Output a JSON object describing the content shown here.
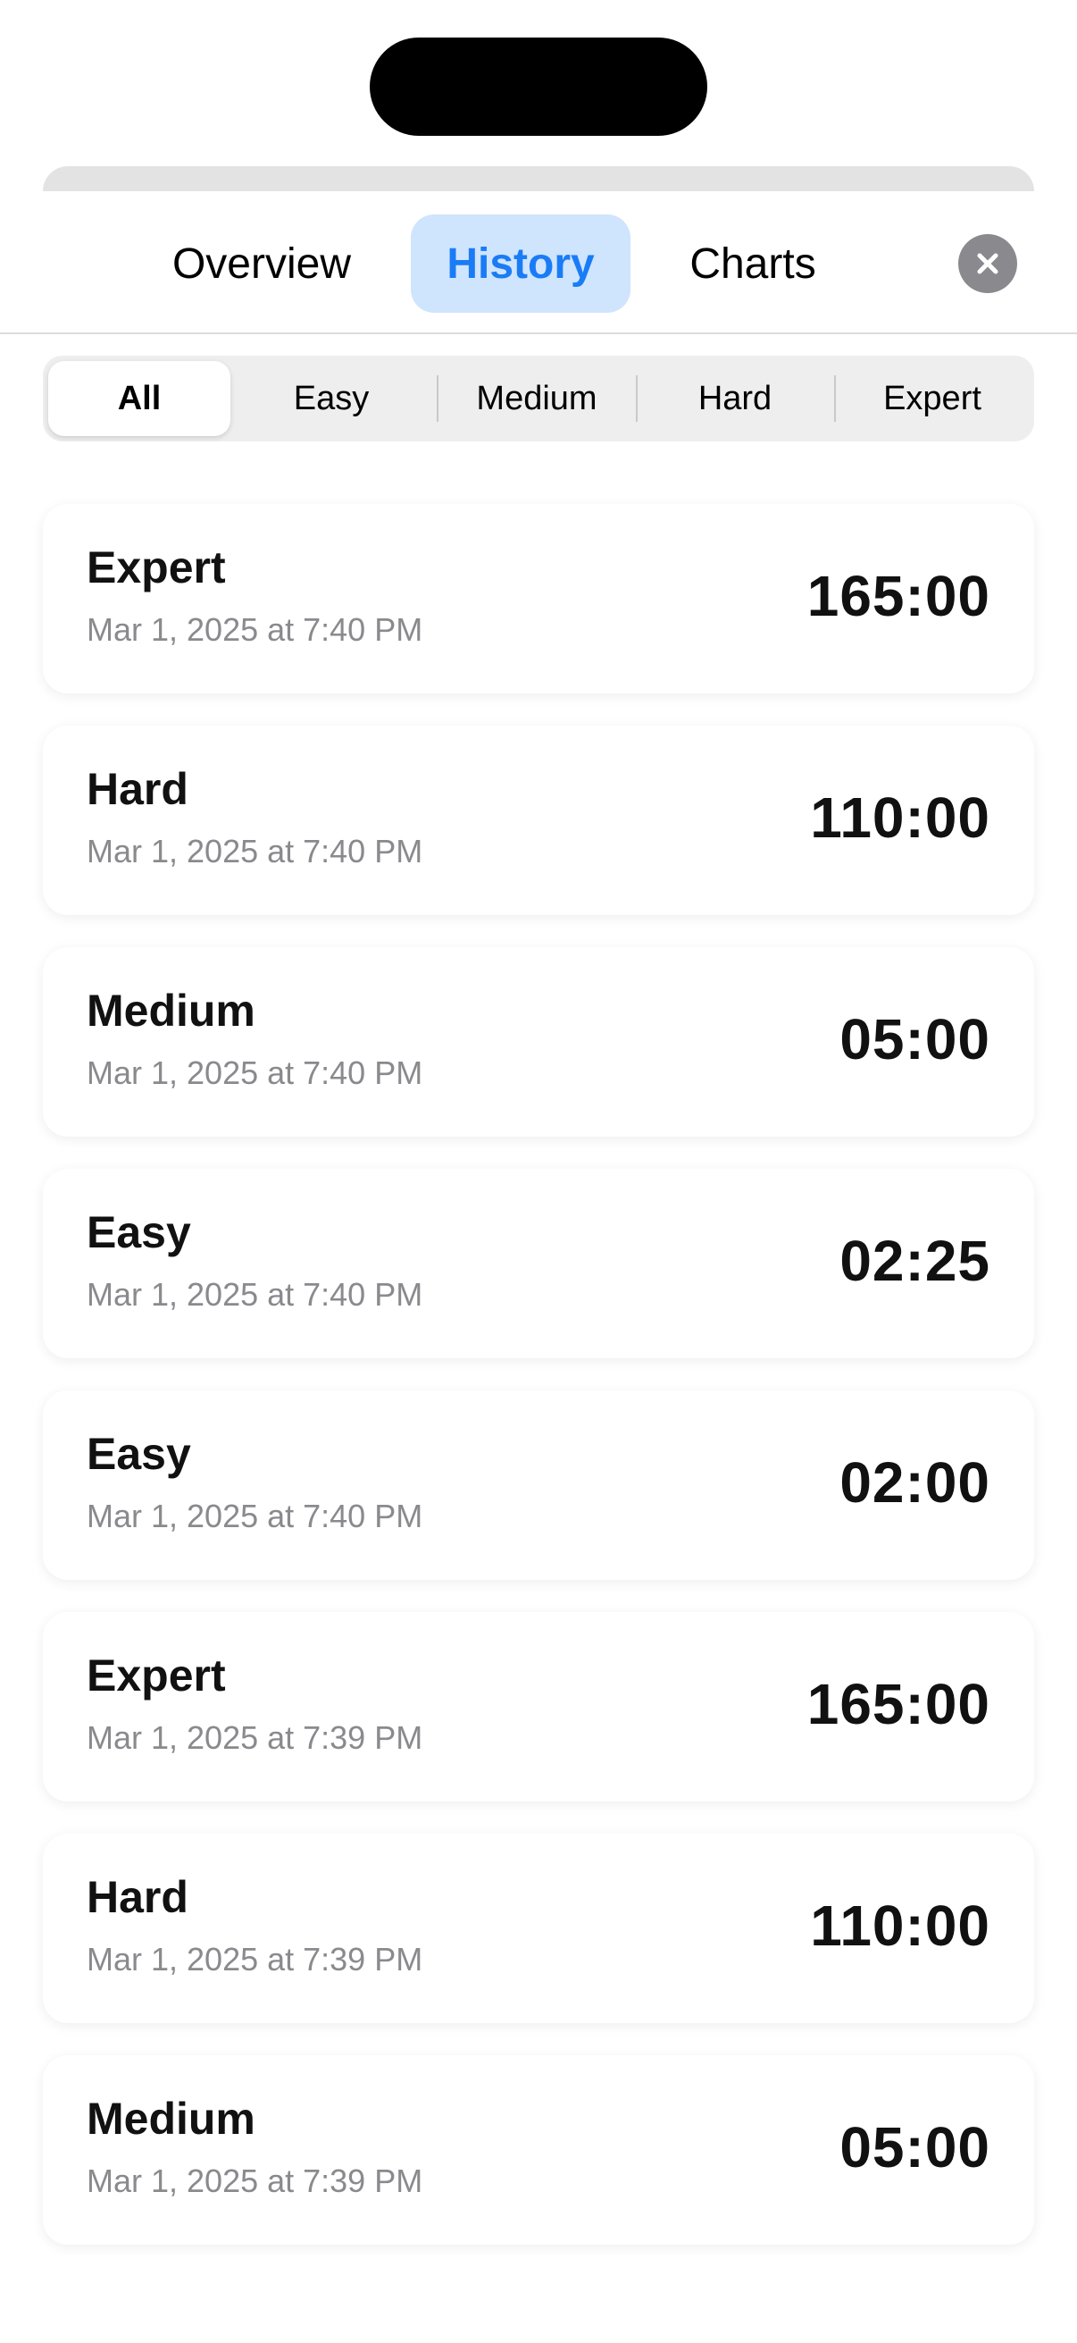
{
  "tabs": {
    "overview": "Overview",
    "history": "History",
    "charts": "Charts",
    "active": "History"
  },
  "close_icon": "xmark-circle-icon",
  "colors": {
    "accent": "#1a7cf5",
    "selected_tab_bg": "#cfe4fd",
    "secondary_text": "#8a8a8e"
  },
  "filter": {
    "options": [
      "All",
      "Easy",
      "Medium",
      "Hard",
      "Expert"
    ],
    "selected": "All"
  },
  "history": [
    {
      "level": "Expert",
      "date": "Mar 1, 2025 at 7:40 PM",
      "time": "165:00"
    },
    {
      "level": "Hard",
      "date": "Mar 1, 2025 at 7:40 PM",
      "time": "110:00"
    },
    {
      "level": "Medium",
      "date": "Mar 1, 2025 at 7:40 PM",
      "time": "05:00"
    },
    {
      "level": "Easy",
      "date": "Mar 1, 2025 at 7:40 PM",
      "time": "02:25"
    },
    {
      "level": "Easy",
      "date": "Mar 1, 2025 at 7:40 PM",
      "time": "02:00"
    },
    {
      "level": "Expert",
      "date": "Mar 1, 2025 at 7:39 PM",
      "time": "165:00"
    },
    {
      "level": "Hard",
      "date": "Mar 1, 2025 at 7:39 PM",
      "time": "110:00"
    },
    {
      "level": "Medium",
      "date": "Mar 1, 2025 at 7:39 PM",
      "time": "05:00"
    }
  ]
}
